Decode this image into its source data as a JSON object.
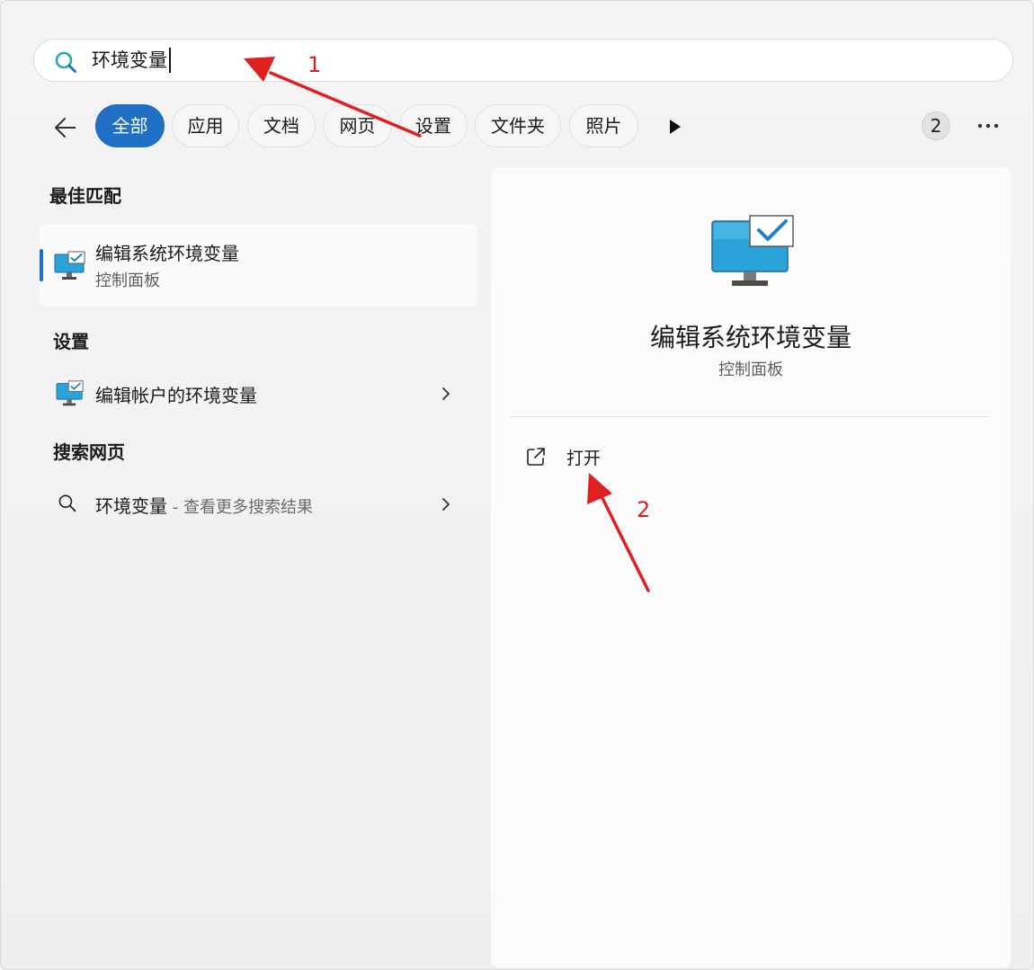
{
  "search": {
    "query": "环境变量"
  },
  "filters": {
    "chips": [
      {
        "label": "全部",
        "active": true
      },
      {
        "label": "应用",
        "active": false
      },
      {
        "label": "文档",
        "active": false
      },
      {
        "label": "网页",
        "active": false
      },
      {
        "label": "设置",
        "active": false
      },
      {
        "label": "文件夹",
        "active": false
      },
      {
        "label": "照片",
        "active": false
      }
    ],
    "count": "2"
  },
  "results": {
    "best_match": {
      "heading": "最佳匹配",
      "title": "编辑系统环境变量",
      "subtitle": "控制面板"
    },
    "settings": {
      "heading": "设置",
      "item": "编辑帐户的环境变量"
    },
    "web": {
      "heading": "搜索网页",
      "query": "环境变量",
      "suffix": " - 查看更多搜索结果"
    }
  },
  "detail": {
    "title": "编辑系统环境变量",
    "subtitle": "控制面板",
    "open_label": "打开"
  },
  "annotations": {
    "step1": "1",
    "step2": "2"
  },
  "colors": {
    "accent": "#1f6fc4",
    "annotation": "#e02020"
  }
}
